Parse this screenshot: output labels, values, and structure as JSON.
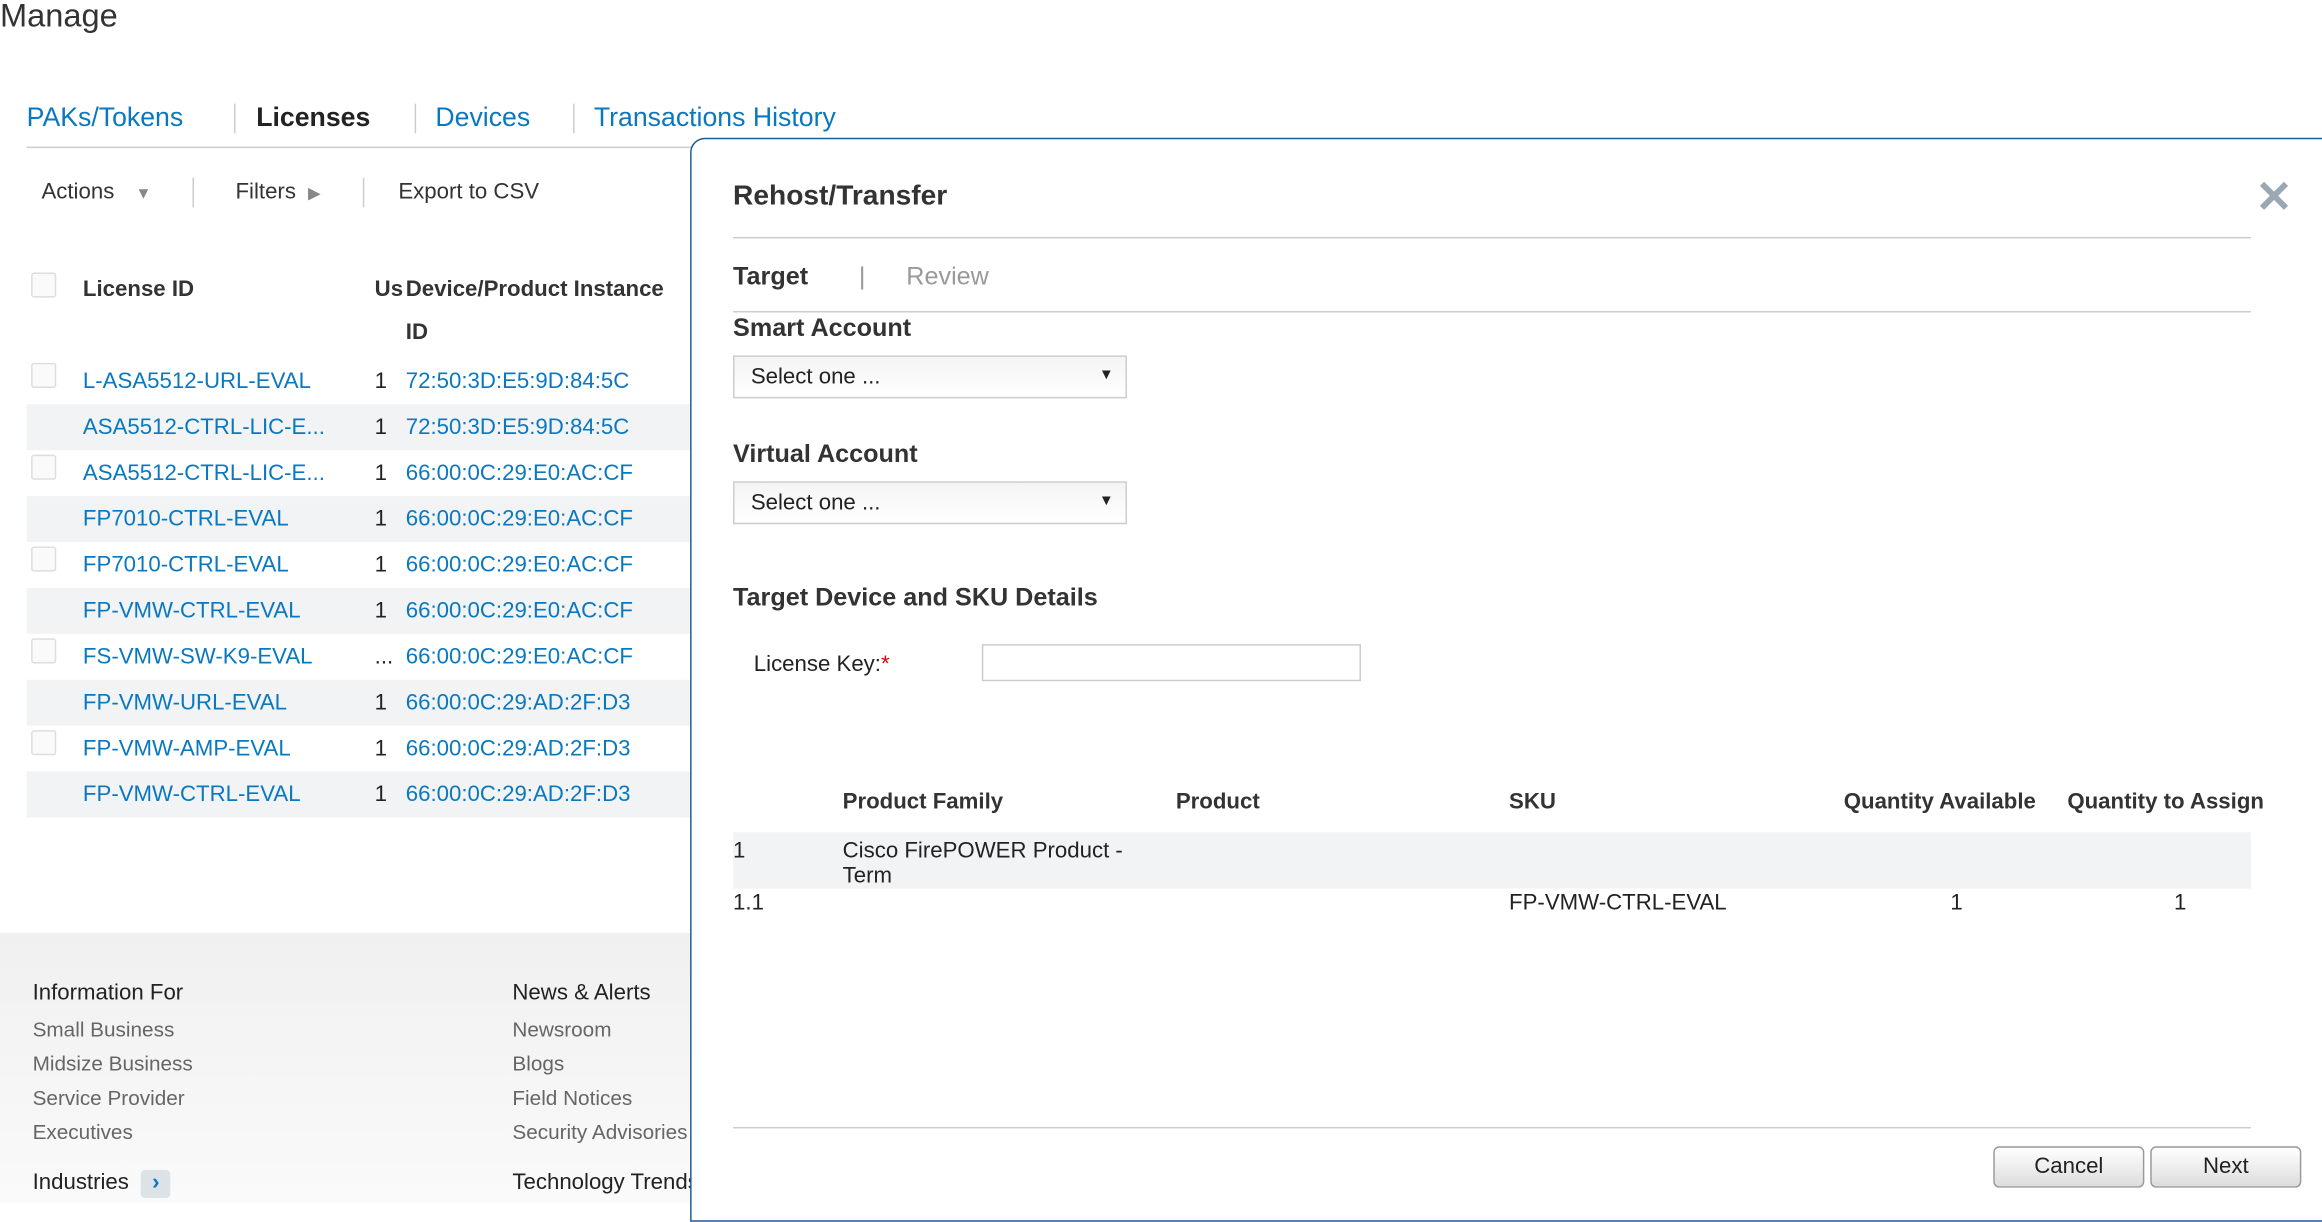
{
  "page": {
    "title": "Manage"
  },
  "tabs": [
    {
      "label": "PAKs/Tokens",
      "active": false
    },
    {
      "label": "Licenses",
      "active": true
    },
    {
      "label": "Devices",
      "active": false
    },
    {
      "label": "Transactions History",
      "active": false
    }
  ],
  "toolbar": {
    "actions": "Actions",
    "filters": "Filters",
    "export": "Export to CSV"
  },
  "table": {
    "headers": {
      "license_id": "License ID",
      "us": "Us",
      "device_line1": "Device/Product Instance",
      "device_line2": "ID"
    },
    "rows": [
      {
        "license": "L-ASA5512-URL-EVAL",
        "us": "1",
        "device": "72:50:3D:E5:9D:84:5C"
      },
      {
        "license": "ASA5512-CTRL-LIC-E...",
        "us": "1",
        "device": "72:50:3D:E5:9D:84:5C"
      },
      {
        "license": "ASA5512-CTRL-LIC-E...",
        "us": "1",
        "device": "66:00:0C:29:E0:AC:CF"
      },
      {
        "license": "FP7010-CTRL-EVAL",
        "us": "1",
        "device": "66:00:0C:29:E0:AC:CF"
      },
      {
        "license": "FP7010-CTRL-EVAL",
        "us": "1",
        "device": "66:00:0C:29:E0:AC:CF"
      },
      {
        "license": "FP-VMW-CTRL-EVAL",
        "us": "1",
        "device": "66:00:0C:29:E0:AC:CF"
      },
      {
        "license": "FS-VMW-SW-K9-EVAL",
        "us": "...",
        "device": "66:00:0C:29:E0:AC:CF"
      },
      {
        "license": "FP-VMW-URL-EVAL",
        "us": "1",
        "device": "66:00:0C:29:AD:2F:D3"
      },
      {
        "license": "FP-VMW-AMP-EVAL",
        "us": "1",
        "device": "66:00:0C:29:AD:2F:D3"
      },
      {
        "license": "FP-VMW-CTRL-EVAL",
        "us": "1",
        "device": "66:00:0C:29:AD:2F:D3"
      }
    ]
  },
  "footer": {
    "col1": {
      "heading": "Information For",
      "links": [
        "Small Business",
        "Midsize Business",
        "Service Provider",
        "Executives"
      ],
      "next": "Industries"
    },
    "col2": {
      "heading": "News & Alerts",
      "links": [
        "Newsroom",
        "Blogs",
        "Field Notices",
        "Security Advisories"
      ],
      "next": "Technology Trends"
    }
  },
  "modal": {
    "title": "Rehost/Transfer",
    "steps": {
      "target": "Target",
      "review": "Review"
    },
    "smart_account": {
      "label": "Smart Account",
      "value": "Select one ..."
    },
    "virtual_account": {
      "label": "Virtual Account",
      "value": "Select one ..."
    },
    "section": "Target Device and SKU Details",
    "license_key": {
      "label": "License Key:",
      "required": "*",
      "value": ""
    },
    "grid": {
      "headers": {
        "family": "Product Family",
        "product": "Product",
        "sku": "SKU",
        "qty_avail": "Quantity Available",
        "qty_assign": "Quantity to Assign"
      },
      "row1": {
        "num": "1",
        "family_l1": "Cisco FirePOWER Product -",
        "family_l2": "Term"
      },
      "row2": {
        "num": "1.1",
        "sku": "FP-VMW-CTRL-EVAL",
        "qty_avail": "1",
        "qty_assign": "1"
      }
    },
    "cancel": "Cancel",
    "next": "Next"
  },
  "colors": {
    "link": "#0a78c0",
    "modal_border": "#1f5c94",
    "required": "#e00000"
  }
}
